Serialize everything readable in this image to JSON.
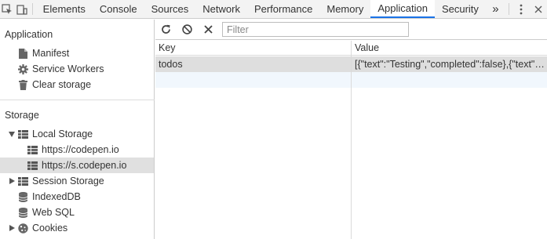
{
  "devtools": {
    "tabs": [
      {
        "label": "Elements"
      },
      {
        "label": "Console"
      },
      {
        "label": "Sources"
      },
      {
        "label": "Network"
      },
      {
        "label": "Performance"
      },
      {
        "label": "Memory"
      },
      {
        "label": "Application"
      },
      {
        "label": "Security"
      }
    ],
    "more_tabs_label": "»",
    "active_tab": "Application",
    "accent_color": "#1a73e8"
  },
  "sidebar": {
    "application_title": "Application",
    "application_items": [
      {
        "label": "Manifest",
        "icon": "document-icon"
      },
      {
        "label": "Service Workers",
        "icon": "gear-icon"
      },
      {
        "label": "Clear storage",
        "icon": "trash-icon"
      }
    ],
    "storage_title": "Storage",
    "local_storage": {
      "label": "Local Storage",
      "icon": "grid-icon",
      "expanded": true,
      "children": [
        {
          "label": "https://codepen.io",
          "selected": false
        },
        {
          "label": "https://s.codepen.io",
          "selected": true
        }
      ]
    },
    "session_storage": {
      "label": "Session Storage",
      "icon": "grid-icon",
      "expanded": false
    },
    "indexed_db": {
      "label": "IndexedDB",
      "icon": "database-icon"
    },
    "web_sql": {
      "label": "Web SQL",
      "icon": "database-icon"
    },
    "cookies": {
      "label": "Cookies",
      "icon": "cookie-icon",
      "expanded": false
    }
  },
  "storage_panel": {
    "filter_placeholder": "Filter",
    "filter_value": "",
    "columns": {
      "key": "Key",
      "value": "Value"
    },
    "rows": [
      {
        "key": "todos",
        "value": "[{\"text\":\"Testing\",\"completed\":false},{\"text\":\"..."
      }
    ]
  }
}
